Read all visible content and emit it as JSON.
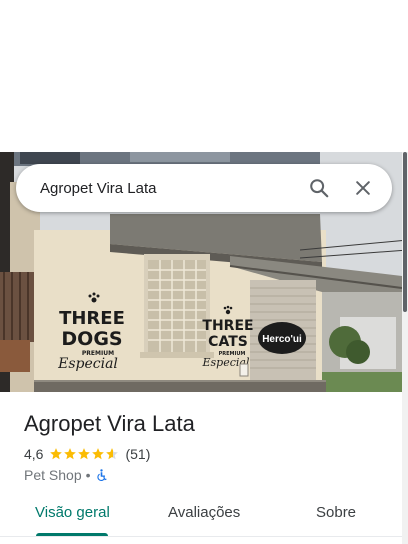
{
  "search": {
    "query": "Agropet Vira Lata"
  },
  "hero": {
    "signs": {
      "dogs_line1": "THREE",
      "dogs_line2": "DOGS",
      "dogs_sub": "PREMIUM",
      "dogs_script": "Especial",
      "cats_line1": "THREE",
      "cats_line2": "CATS",
      "cats_sub": "PREMIUM",
      "cats_script": "Especial",
      "round_sign": "Herco'ui"
    }
  },
  "place": {
    "title": "Agropet Vira Lata",
    "rating": "4,6",
    "rating_value": 4.6,
    "review_count": "(51)",
    "category": "Pet Shop",
    "separator": "•",
    "accessibility_icon": "wheelchair-icon"
  },
  "tabs": [
    {
      "label": "Visão geral",
      "active": true
    },
    {
      "label": "Avaliações",
      "active": false
    },
    {
      "label": "Sobre",
      "active": false
    }
  ],
  "colors": {
    "accent": "#00796b",
    "star": "#fbbc04",
    "accessibility": "#1a73e8"
  }
}
